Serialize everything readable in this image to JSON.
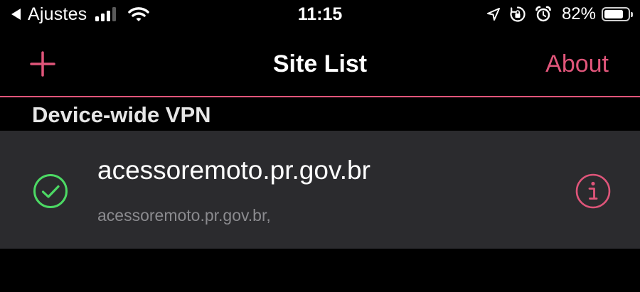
{
  "status_bar": {
    "back_label": "Ajustes",
    "time": "11:15",
    "battery_percent": "82%",
    "battery_level": 0.82,
    "signal_bars_active": 3,
    "signal_bars_total": 4,
    "icons": [
      "back-triangle-icon",
      "cellular-signal-icon",
      "wifi-icon",
      "location-arrow-icon",
      "orientation-lock-icon",
      "alarm-clock-icon",
      "battery-icon"
    ]
  },
  "nav": {
    "title": "Site List",
    "about_label": "About",
    "add_icon": "plus-icon"
  },
  "section": {
    "header": "Device-wide VPN"
  },
  "site": {
    "name": "acessoremoto.pr.gov.br",
    "subtitle": "acessoremoto.pr.gov.br,",
    "status_icon": "check-circle-icon",
    "info_icon": "info-circle-icon"
  },
  "colors": {
    "accent": "#e0557a",
    "check": "#4cd964",
    "background": "#000000",
    "row_background": "#2b2b2e",
    "subtitle": "#8b8b8f"
  }
}
